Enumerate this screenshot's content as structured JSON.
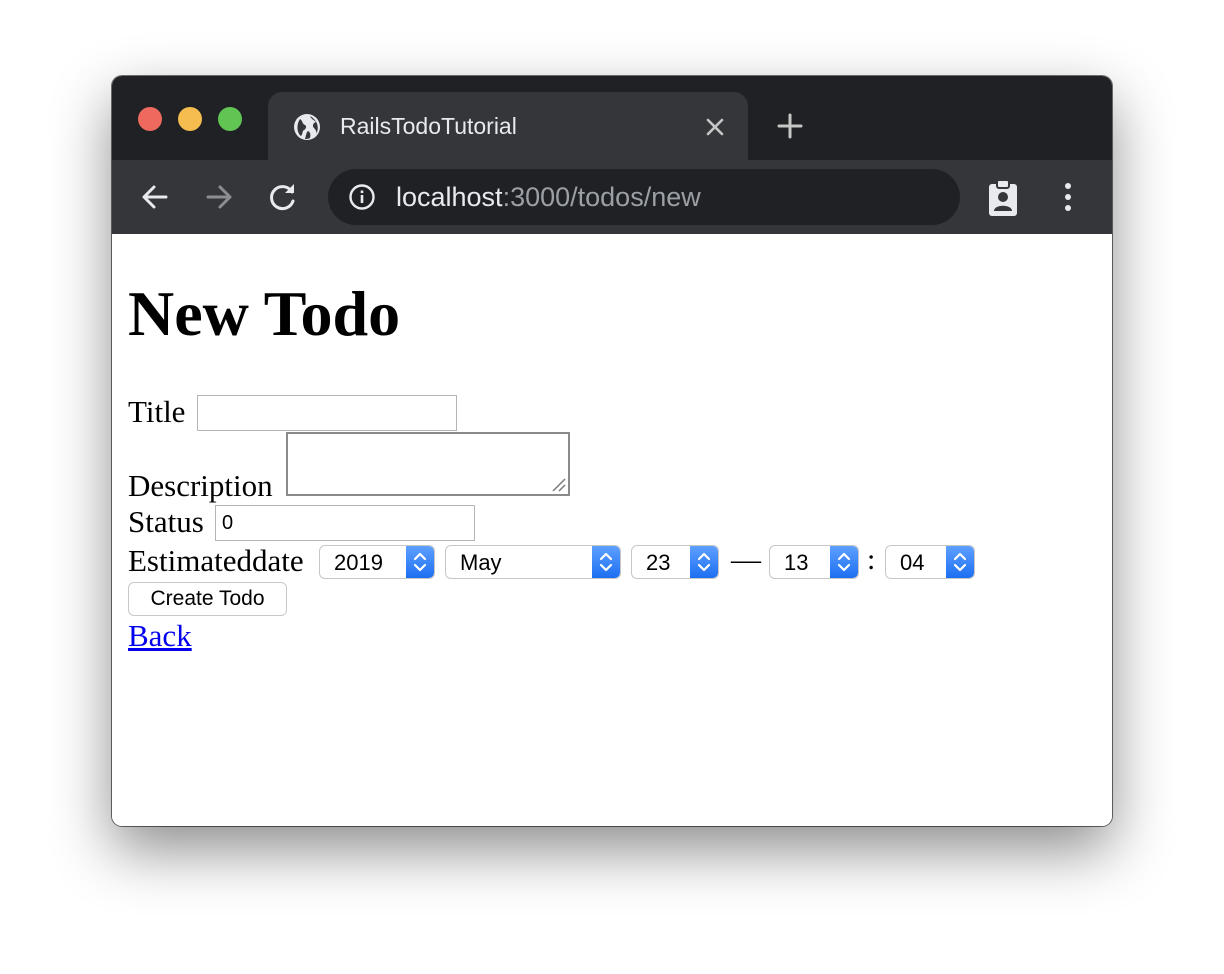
{
  "colors": {
    "traffic_close": "#ee6a5e",
    "traffic_minimize": "#f5bd4f",
    "traffic_maximize": "#61c554",
    "link": "#0000ee",
    "select_accent": "#2f7ff7"
  },
  "browser": {
    "tab": {
      "title": "RailsTodoTutorial",
      "icon": "globe-icon"
    },
    "address_bar": {
      "host": "localhost",
      "path": ":3000/todos/new"
    }
  },
  "page": {
    "heading": "New Todo",
    "form": {
      "title": {
        "label": "Title",
        "value": ""
      },
      "description": {
        "label": "Description",
        "value": ""
      },
      "status": {
        "label": "Status",
        "value": "0"
      },
      "estimated_date": {
        "label": "Estimateddate",
        "year": "2019",
        "month": "May",
        "day": "23",
        "date_time_separator": "—",
        "hour": "13",
        "time_separator": ":",
        "minute": "04"
      },
      "submit_label": "Create Todo"
    },
    "back_link": "Back"
  }
}
